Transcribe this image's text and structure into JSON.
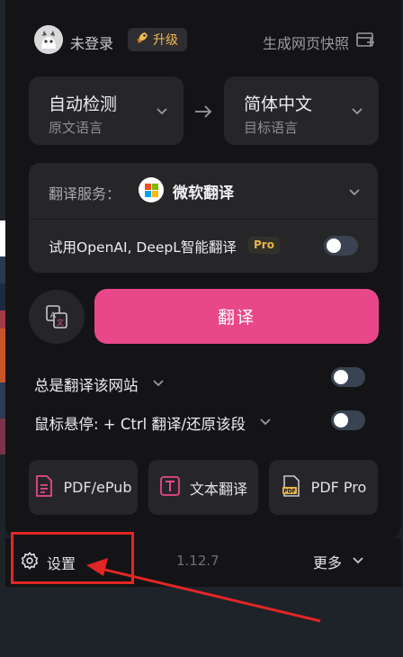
{
  "header": {
    "login_text": "未登录",
    "upgrade_label": "升级",
    "snapshot_label": "生成网页快照"
  },
  "languages": {
    "source": {
      "main": "自动检测",
      "sub": "原文语言"
    },
    "target": {
      "main": "简体中文",
      "sub": "目标语言"
    }
  },
  "service": {
    "label": "翻译服务：",
    "value": "微软翻译",
    "openai_label": "试用OpenAI, DeepL智能翻译",
    "pro_badge": "Pro"
  },
  "translate_button": "翻译",
  "options": {
    "always_translate": "总是翻译该网站",
    "hover_label": "鼠标悬停:  + Ctrl 翻译/还原该段"
  },
  "tools": [
    {
      "label": "PDF/ePub",
      "icon": "pdf-file-icon"
    },
    {
      "label": "文本翻译",
      "icon": "text-t-icon"
    },
    {
      "label": "PDF Pro",
      "icon": "pdf-pro-icon"
    }
  ],
  "footer": {
    "settings_label": "设置",
    "version": "1.12.7",
    "more_label": "更多"
  },
  "colors": {
    "accent": "#e8488a",
    "panel": "#141416",
    "card": "#262629",
    "pro": "#e7b54c",
    "annotation": "#e12626"
  }
}
